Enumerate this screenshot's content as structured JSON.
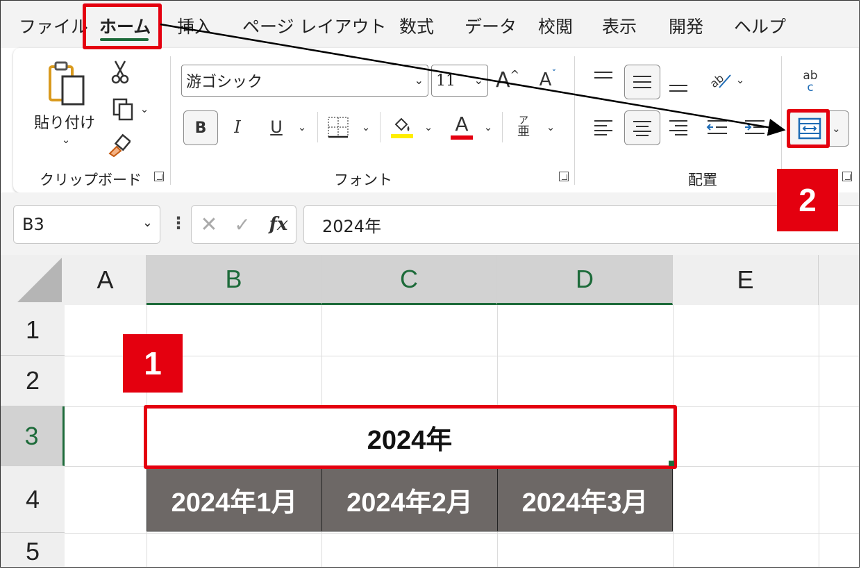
{
  "menu": {
    "tabs": [
      {
        "label": "ファイル"
      },
      {
        "label": "ホーム"
      },
      {
        "label": "挿入"
      },
      {
        "label": "ページ レイアウト"
      },
      {
        "label": "数式"
      },
      {
        "label": "データ"
      },
      {
        "label": "校閲"
      },
      {
        "label": "表示"
      },
      {
        "label": "開発"
      },
      {
        "label": "ヘルプ"
      }
    ]
  },
  "ribbon": {
    "clipboard": {
      "paste_label": "貼り付け",
      "group_label": "クリップボード"
    },
    "font": {
      "font_name": "游ゴシック",
      "font_size": "11",
      "bold_label": "B",
      "italic_label": "I",
      "underline_label": "U",
      "font_color_label": "A",
      "grow_label": "A",
      "shrink_label": "A",
      "phonetic_top": "ア",
      "phonetic_bottom": "亜",
      "group_label": "フォント",
      "fill_color": "#ffee00",
      "text_color": "#e4000f"
    },
    "alignment": {
      "group_label": "配置",
      "wrap_top": "ab",
      "wrap_bottom": "c"
    }
  },
  "formula_bar": {
    "name_box": "B3",
    "fx_label": "fx",
    "formula": "2024年"
  },
  "grid": {
    "columns": [
      "A",
      "B",
      "C",
      "D",
      "E"
    ],
    "rows": [
      "1",
      "2",
      "3",
      "4",
      "5"
    ],
    "b3_value": "2024年",
    "month_cells": [
      "2024年1月",
      "2024年2月",
      "2024年3月"
    ]
  },
  "annotations": {
    "badge_1": "1",
    "badge_2": "2",
    "highlight_color": "#e4000f"
  }
}
